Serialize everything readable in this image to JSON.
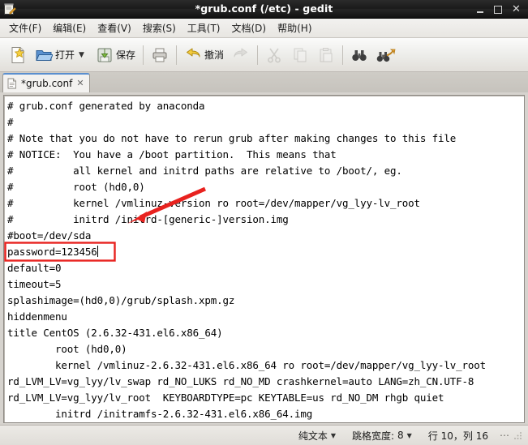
{
  "window": {
    "title": "*grub.conf (/etc) - gedit",
    "icon": "gedit-icon",
    "controls": {
      "minimize": "–",
      "maximize": "▫",
      "close": "✕"
    }
  },
  "menubar": {
    "items": [
      {
        "label": "文件(F)",
        "name": "menu-file"
      },
      {
        "label": "编辑(E)",
        "name": "menu-edit"
      },
      {
        "label": "查看(V)",
        "name": "menu-view"
      },
      {
        "label": "搜索(S)",
        "name": "menu-search"
      },
      {
        "label": "工具(T)",
        "name": "menu-tools"
      },
      {
        "label": "文档(D)",
        "name": "menu-documents"
      },
      {
        "label": "帮助(H)",
        "name": "menu-help"
      }
    ]
  },
  "toolbar": {
    "new_label": "",
    "open_label": "打开",
    "save_label": "保存",
    "print_label": "",
    "undo_label": "撤消",
    "redo_label": "",
    "dropdown_chevron": "▼"
  },
  "tabs": [
    {
      "label": "*grub.conf",
      "close": "✕",
      "active": true
    }
  ],
  "editor": {
    "lines": [
      "# grub.conf generated by anaconda",
      "#",
      "# Note that you do not have to rerun grub after making changes to this file",
      "# NOTICE:  You have a /boot partition.  This means that",
      "#          all kernel and initrd paths are relative to /boot/, eg.",
      "#          root (hd0,0)",
      "#          kernel /vmlinuz-version ro root=/dev/mapper/vg_lyy-lv_root",
      "#          initrd /initrd-[generic-]version.img",
      "#boot=/dev/sda",
      "password=123456",
      "default=0",
      "timeout=5",
      "splashimage=(hd0,0)/grub/splash.xpm.gz",
      "hiddenmenu",
      "title CentOS (2.6.32-431.el6.x86_64)",
      "        root (hd0,0)",
      "        kernel /vmlinuz-2.6.32-431.el6.x86_64 ro root=/dev/mapper/vg_lyy-lv_root",
      "rd_LVM_LV=vg_lyy/lv_swap rd_NO_LUKS rd_NO_MD crashkernel=auto LANG=zh_CN.UTF-8",
      "rd_LVM_LV=vg_lyy/lv_root  KEYBOARDTYPE=pc KEYTABLE=us rd_NO_DM rhgb quiet",
      "        initrd /initramfs-2.6.32-431.el6.x86_64.img"
    ],
    "highlighted_line_index": 9,
    "highlighted_line_text": "password=123456"
  },
  "annotations": {
    "box_color": "#e8221f",
    "arrow_color": "#e8221f"
  },
  "statusbar": {
    "encoding_label": "纯文本",
    "encoding_chevron": "▼",
    "tab_width_label": "跳格宽度:",
    "tab_width_value": "8",
    "tab_width_chevron": "▼",
    "position_label": "行 10，列 16",
    "overflow": "⋯"
  }
}
